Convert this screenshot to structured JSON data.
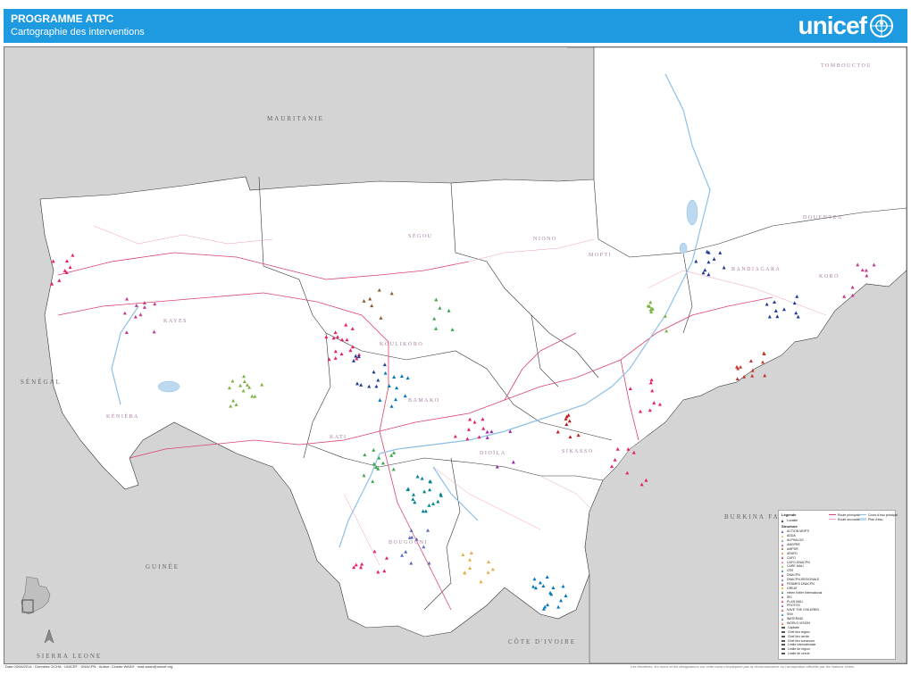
{
  "header": {
    "title": "PROGRAMME ATPC",
    "subtitle": "Cartographie des interventions",
    "logo_text": "unicef",
    "logo_icon": "unicef-globe-icon",
    "bar_color": "#1e9ae0"
  },
  "map": {
    "colors": {
      "background_country": "#d4d4d4",
      "mali": "#ffffff",
      "region_border": "#333333",
      "road_primary": "#d9436e",
      "road_secondary": "#e8a0b8",
      "river": "#8dbfe6"
    },
    "neighbour_countries": [
      {
        "name": "MAURITANIE"
      },
      {
        "name": "SÉNÉGAL"
      },
      {
        "name": "GUINÉE"
      },
      {
        "name": "SIERRA LEONE"
      },
      {
        "name": "CÔTE D'IVOIRE"
      },
      {
        "name": "BURKINA FASO"
      }
    ],
    "regions": [
      {
        "name": "KAYES"
      },
      {
        "name": "KOULIKORO"
      },
      {
        "name": "SÉGOU"
      },
      {
        "name": "MOPTI"
      },
      {
        "name": "TOMBOUCTOU"
      },
      {
        "name": "SIKASSO"
      },
      {
        "name": "BAMAKO"
      },
      {
        "name": "KÉNIÉBA"
      },
      {
        "name": "KATI"
      },
      {
        "name": "DIOÏLA"
      },
      {
        "name": "BANDIAGARA"
      },
      {
        "name": "KORO"
      },
      {
        "name": "DOUENTZA"
      },
      {
        "name": "NIONO"
      },
      {
        "name": "BOUGOUNI"
      }
    ]
  },
  "legend": {
    "title": "Légende",
    "marker_label": "Localité",
    "structures_title": "Structure",
    "structures": [
      {
        "name": "ACTION MOPTI",
        "color": "#1f3a93"
      },
      {
        "name": "ADDA",
        "color": "#e3b04b"
      },
      {
        "name": "ALPHALOG",
        "color": "#3ca34a"
      },
      {
        "name": "AMSPRE",
        "color": "#c43a8b"
      },
      {
        "name": "AMPDR",
        "color": "#8a5a2b"
      },
      {
        "name": "ARAFD",
        "color": "#e67e22"
      },
      {
        "name": "CAFO",
        "color": "#b71c1c"
      },
      {
        "name": "CAFO-DNACPN",
        "color": "#f06292"
      },
      {
        "name": "CARE MALI",
        "color": "#7cb342"
      },
      {
        "name": "CRS",
        "color": "#00838f"
      },
      {
        "name": "DNACPN",
        "color": "#6a1b9a"
      },
      {
        "name": "DNACPN-REGIONALE",
        "color": "#5c6bc0"
      },
      {
        "name": "FEMMES DNACPN",
        "color": "#ad1457"
      },
      {
        "name": "GREAT",
        "color": "#ff9800"
      },
      {
        "name": "Helen Keller International",
        "color": "#2e7d32"
      },
      {
        "name": "IRC",
        "color": "#795548"
      },
      {
        "name": "PLAN MALI",
        "color": "#e91e63"
      },
      {
        "name": "PROTOS",
        "color": "#9c27b0"
      },
      {
        "name": "SAVE THE CHILDREN",
        "color": "#c0392b"
      },
      {
        "name": "SNV",
        "color": "#0277bd"
      },
      {
        "name": "WATERAID",
        "color": "#546e7a"
      },
      {
        "name": "WORLD VISION",
        "color": "#ff5722"
      }
    ],
    "admin": [
      "Capitale",
      "Chef lieu région",
      "Chef lieu cercle",
      "Chef lieu commune",
      "Limite internationale",
      "Limite de région",
      "Limite de cercle"
    ],
    "roads_title": "Route principale",
    "roads": [
      {
        "name": "Route principale",
        "color": "#d9436e"
      },
      {
        "name": "Route secondaire",
        "color": "#e8a0b8"
      }
    ],
    "water": [
      {
        "name": "Cours d'eau principal",
        "color": "#8dbfe6"
      },
      {
        "name": "Plan d'eau",
        "color": "#bcd9f0"
      }
    ]
  },
  "footer": {
    "credit": "Date 03/06/2014 · Données: DCHA · UNICEF · DNACPN · Auteur: Cluster WASH · mali.wash@unicef.org",
    "disclaimer": "Les frontières, les noms et les désignations sur cette carte n'impliquent pas la reconnaissance ou l'acceptation officielle par les Nations Unies."
  }
}
